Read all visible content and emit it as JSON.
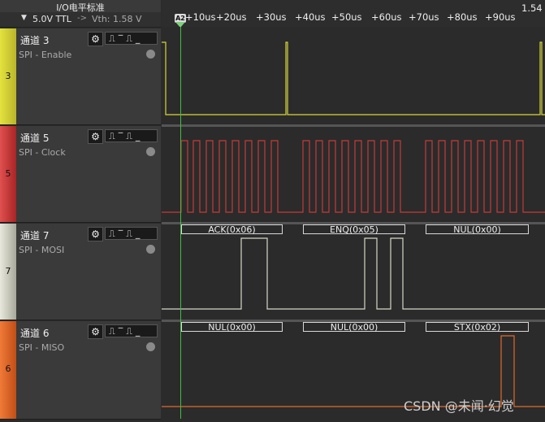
{
  "header": {
    "title": "I/O电平标准",
    "level": "5.0V TTL",
    "arrow": "->",
    "vth": "Vth: 1.58 V"
  },
  "timeline": {
    "ticks": [
      "+10us",
      "+20us",
      "+30us",
      "+40us",
      "+50us",
      "+60us",
      "+70us",
      "+80us",
      "+90us",
      "1.54"
    ],
    "cursor_label": "A2"
  },
  "channels": [
    {
      "name": "通道 3",
      "label": "SPI - Enable",
      "number": "3",
      "color": "#d7d53a"
    },
    {
      "name": "通道 5",
      "label": "SPI - Clock",
      "number": "5",
      "color": "#c63a3a"
    },
    {
      "name": "通道 7",
      "label": "SPI - MOSI",
      "number": "7",
      "color": "#d6d6c6"
    },
    {
      "name": "通道 6",
      "label": "SPI - MISO",
      "number": "6",
      "color": "#e06a2a"
    }
  ],
  "icons": {
    "gear": "gear-icon",
    "trigger": "trigger-edge-icons",
    "status": "status-dot-icon"
  },
  "decode": {
    "mosi": [
      "ACK(0x06)",
      "ENQ(0x05)",
      "NUL(0x00)"
    ],
    "miso": [
      "NUL(0x00)",
      "NUL(0x00)",
      "STX(0x02)"
    ]
  },
  "watermark": "CSDN @未闻·幻觉"
}
